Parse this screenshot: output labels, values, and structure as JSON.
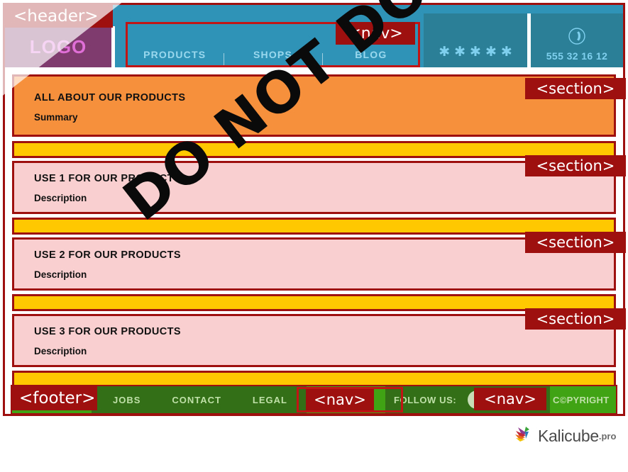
{
  "watermark": {
    "text": "DO NOT DO THIS"
  },
  "tags": {
    "header": "<header>",
    "nav": "<nav>",
    "section": "<section>",
    "footer": "<footer>"
  },
  "header": {
    "logo": "LOGO",
    "nav_items": [
      {
        "label": "PRODUCTS"
      },
      {
        "label": "SHOPS"
      },
      {
        "label": "BLOG"
      }
    ],
    "rating": {
      "icon": "star-icon",
      "stars": 5,
      "glyph": "✱"
    },
    "phone": {
      "icon": "phone-icon",
      "number": "555 32 16 12"
    }
  },
  "sections": [
    {
      "title": "ALL ABOUT OUR PRODUCTS",
      "subtitle": "Summary",
      "style": "hero"
    },
    {
      "title": "USE 1 FOR OUR PRODUCTS",
      "subtitle": "Description",
      "style": "pink"
    },
    {
      "title": "USE 2 FOR OUR PRODUCTS",
      "subtitle": "Description",
      "style": "pink"
    },
    {
      "title": "USE 3 FOR OUR PRODUCTS",
      "subtitle": "Description",
      "style": "pink"
    }
  ],
  "footer": {
    "links": [
      {
        "label": "JOBS"
      },
      {
        "label": "CONTACT"
      },
      {
        "label": "LEGAL"
      }
    ],
    "follow_label": "FOLLOW US:",
    "social": [
      {
        "icon": "social-icon-1"
      },
      {
        "icon": "social-icon-2"
      },
      {
        "icon": "social-icon-3"
      }
    ],
    "copyright": "C©PYRIGHT"
  },
  "branding": {
    "name": "Kalicube",
    "suffix": ".pro",
    "icon": "kalicube-bird-icon"
  },
  "colors": {
    "tag_red": "#9e1010",
    "outline_red": "#c11414",
    "header_blue": "#2f93b8",
    "cell_blue": "#2b7f96",
    "logo_purple": "#7f3a6e",
    "logo_pink": "#e070d8",
    "hero_orange": "#f7903d",
    "section_pink": "#f9cfcf",
    "separator_yellow": "#ffc800",
    "footer_green": "#3fa314",
    "footer_nav_green": "#336f16"
  }
}
